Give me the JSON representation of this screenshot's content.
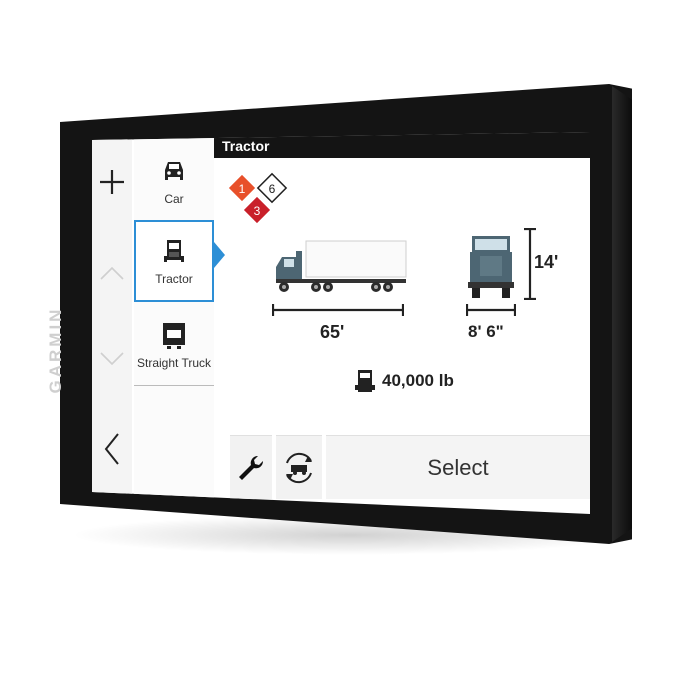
{
  "device": {
    "brand": "GARMIN"
  },
  "header": {
    "title": "Tractor"
  },
  "profiles": [
    {
      "label": "Car",
      "icon": "car-icon"
    },
    {
      "label": "Tractor",
      "icon": "tractor-icon",
      "selected": true
    },
    {
      "label": "Straight Truck",
      "icon": "straight-truck-icon"
    }
  ],
  "hazmat": {
    "class_1": "1",
    "class_3": "3",
    "class_6": "6"
  },
  "dimensions": {
    "length": "65'",
    "width": "8' 6\"",
    "height": "14'"
  },
  "weight": {
    "value": "40,000 lb"
  },
  "actions": {
    "select_label": "Select"
  },
  "colors": {
    "accent": "#2d8fd6",
    "header_bg": "#141414",
    "hazmat_1": "#e8502a",
    "hazmat_3": "#c9202a",
    "truck": "#4d6673"
  }
}
